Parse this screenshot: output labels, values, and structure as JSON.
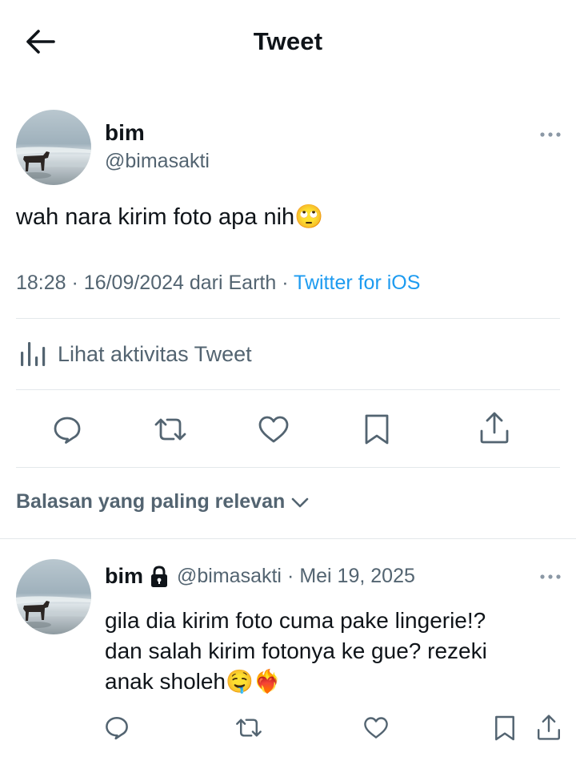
{
  "header": {
    "title": "Tweet",
    "back_icon": "arrow-left-icon"
  },
  "tweet": {
    "author_name": "bim",
    "author_handle": "@bimasakti",
    "text": "wah nara kirim foto apa nih🙄",
    "time": "18:28",
    "date": "16/09/2024",
    "location": "dari Earth",
    "source": "Twitter for iOS",
    "more_icon": "more-horizontal-icon"
  },
  "activity": {
    "label": "Lihat aktivitas Tweet",
    "icon": "analytics-bars-icon"
  },
  "actions": {
    "icons": [
      "reply-icon",
      "retweet-icon",
      "like-icon",
      "bookmark-icon",
      "share-icon"
    ]
  },
  "replies_sort": {
    "label": "Balasan yang paling relevan",
    "icon": "chevron-down-icon"
  },
  "reply": {
    "author_name": "bim",
    "author_handle": "@bimasakti",
    "separator": "·",
    "date": "Mei 19, 2025",
    "lines": [
      "gila dia kirim foto cuma pake lingerie!?",
      "dan salah kirim fotonya ke gue? rezeki",
      "anak sholeh🤤❤️‍🔥"
    ],
    "lock_icon": "lock-icon"
  },
  "colors": {
    "text_primary": "#0f1419",
    "text_secondary": "#536471",
    "link": "#1d9bf0",
    "divider": "#e3e8eb"
  }
}
